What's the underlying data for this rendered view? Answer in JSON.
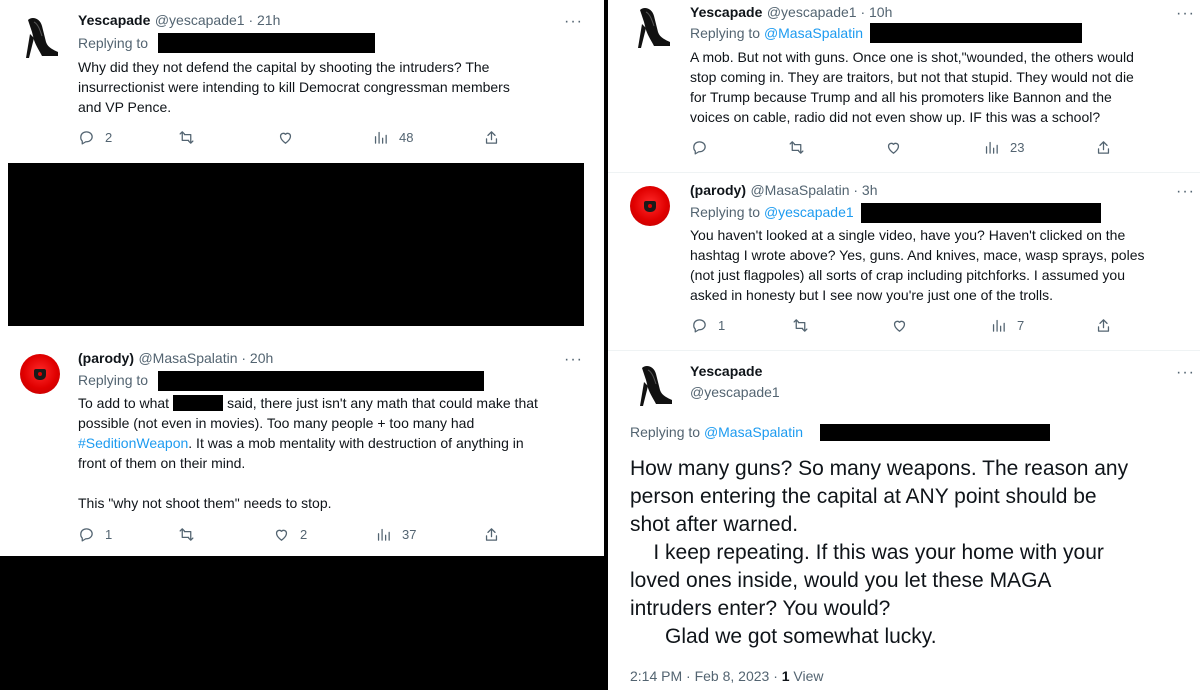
{
  "tweets": [
    {
      "name": "Yescapade",
      "handle": "@yescapade1 · 21h",
      "replying_prefix": "Replying to",
      "reply_link": "",
      "lines": [
        "Why did they not defend the capital by shooting the intruders? The",
        "insurrectionist were intending to kill Democrat congressman members",
        "and VP Pence."
      ],
      "counts": {
        "reply": "2",
        "retweet": "",
        "like": "",
        "views": "48"
      }
    },
    {
      "name": "(parody)",
      "handle": "@MasaSpalatin · 20h",
      "replying_prefix": "Replying to",
      "reply_link": "",
      "line1_a": "To add to what",
      "line1_b": "said, there just isn't any math that could make that",
      "line2": "possible (not even in movies). Too many people + too many had",
      "hashtag": "#SeditionWeapon",
      "line3_rest": ". It was a mob mentality with destruction of anything in",
      "line4": "front of them on their mind.",
      "line5": "This \"why not shoot them\" needs to stop.",
      "counts": {
        "reply": "1",
        "retweet": "",
        "like": "2",
        "views": "37"
      }
    },
    {
      "name": "Yescapade",
      "handle": "@yescapade1 · 10h",
      "replying_prefix": "Replying to",
      "reply_link": "@MasaSpalatin",
      "lines": [
        "A mob. But not with guns. Once one is shot,\"wounded, the others would",
        "stop coming in. They are traitors, but not that stupid. They would not die",
        "for Trump because Trump and all his promoters like Bannon and the",
        "voices on cable, radio did not even show up. IF this was a school?"
      ],
      "counts": {
        "reply": "",
        "retweet": "",
        "like": "",
        "views": "23"
      }
    },
    {
      "name": "(parody)",
      "handle": "@MasaSpalatin · 3h",
      "replying_prefix": "Replying to",
      "reply_link": "@yescapade1",
      "lines": [
        "You haven't looked at a single video, have you? Haven't clicked on the",
        "hashtag I wrote above? Yes, guns. And knives, mace, wasp sprays, poles",
        "(not just flagpoles) all sorts of crap including pitchforks. I assumed you",
        "asked in honesty but I see now you're just one of the trolls."
      ],
      "counts": {
        "reply": "1",
        "retweet": "",
        "like": "",
        "views": "7"
      }
    }
  ],
  "main": {
    "name": "Yescapade",
    "handle": "@yescapade1",
    "replying_prefix": "Replying to",
    "reply_link": "@MasaSpalatin",
    "text": "How many guns? So many weapons. The reason any\nperson entering the capital at ANY point should be\nshot after warned.\n    I keep repeating. If this was your home with your\nloved ones inside, would you let these MAGA\nintruders enter? You would?\n      Glad we got somewhat lucky.",
    "timestamp": "2:14 PM · Feb 8, 2023 · ",
    "views_count": "1",
    "views_label": " View"
  },
  "more_glyph": "···",
  "icons": [
    "more-icon",
    "reply-icon",
    "retweet-icon",
    "like-icon",
    "views-icon",
    "share-icon"
  ],
  "colors": {
    "link": "#1d9bf0",
    "muted": "#536471",
    "text": "#0f1419",
    "avatar_red": "#e00000"
  }
}
